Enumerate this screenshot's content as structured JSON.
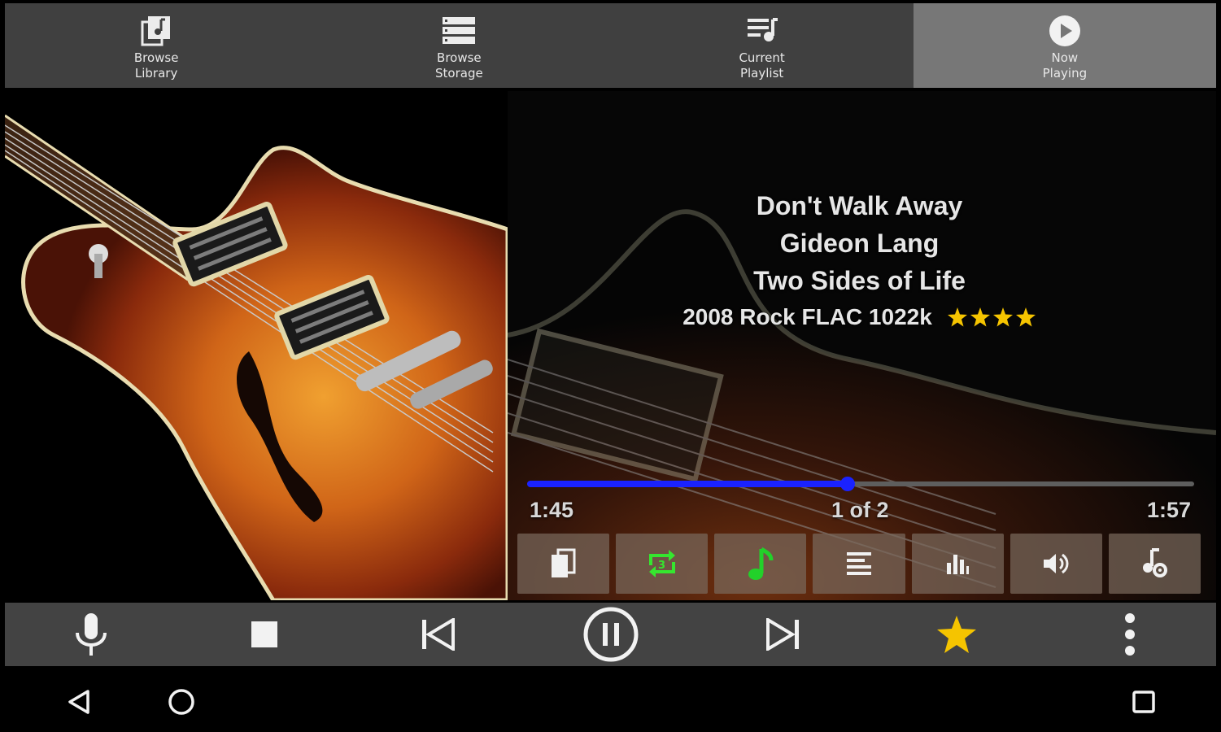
{
  "tabs": [
    {
      "label": "Browse\nLibrary",
      "icon": "library-music-icon",
      "active": false
    },
    {
      "label": "Browse\nStorage",
      "icon": "storage-list-icon",
      "active": false
    },
    {
      "label": "Current\nPlaylist",
      "icon": "playlist-icon",
      "active": false
    },
    {
      "label": "Now\nPlaying",
      "icon": "play-circle-icon",
      "active": true
    }
  ],
  "track": {
    "title": "Don't Walk Away",
    "artist": "Gideon Lang",
    "album": "Two Sides of Life",
    "meta": "2008 Rock FLAC 1022k",
    "rating": 4
  },
  "progress": {
    "elapsed": "1:45",
    "duration": "1:57",
    "position": "1 of 2",
    "fraction": 0.48
  },
  "action_buttons": [
    {
      "icon": "bookmarks-icon"
    },
    {
      "icon": "repeat-icon"
    },
    {
      "icon": "music-note-icon"
    },
    {
      "icon": "lyrics-icon"
    },
    {
      "icon": "equalizer-icon"
    },
    {
      "icon": "volume-icon"
    },
    {
      "icon": "music-settings-icon"
    }
  ],
  "controls": [
    {
      "icon": "microphone-icon"
    },
    {
      "icon": "stop-icon"
    },
    {
      "icon": "previous-icon"
    },
    {
      "icon": "pause-icon"
    },
    {
      "icon": "next-icon"
    },
    {
      "icon": "favorite-star-icon"
    },
    {
      "icon": "more-options-icon"
    }
  ],
  "colors": {
    "accent": "#1a22ff",
    "star": "#f5c400",
    "repeat": "#35e62f",
    "note": "#22d12a",
    "active_tab": "#777777",
    "bar": "#434343"
  }
}
